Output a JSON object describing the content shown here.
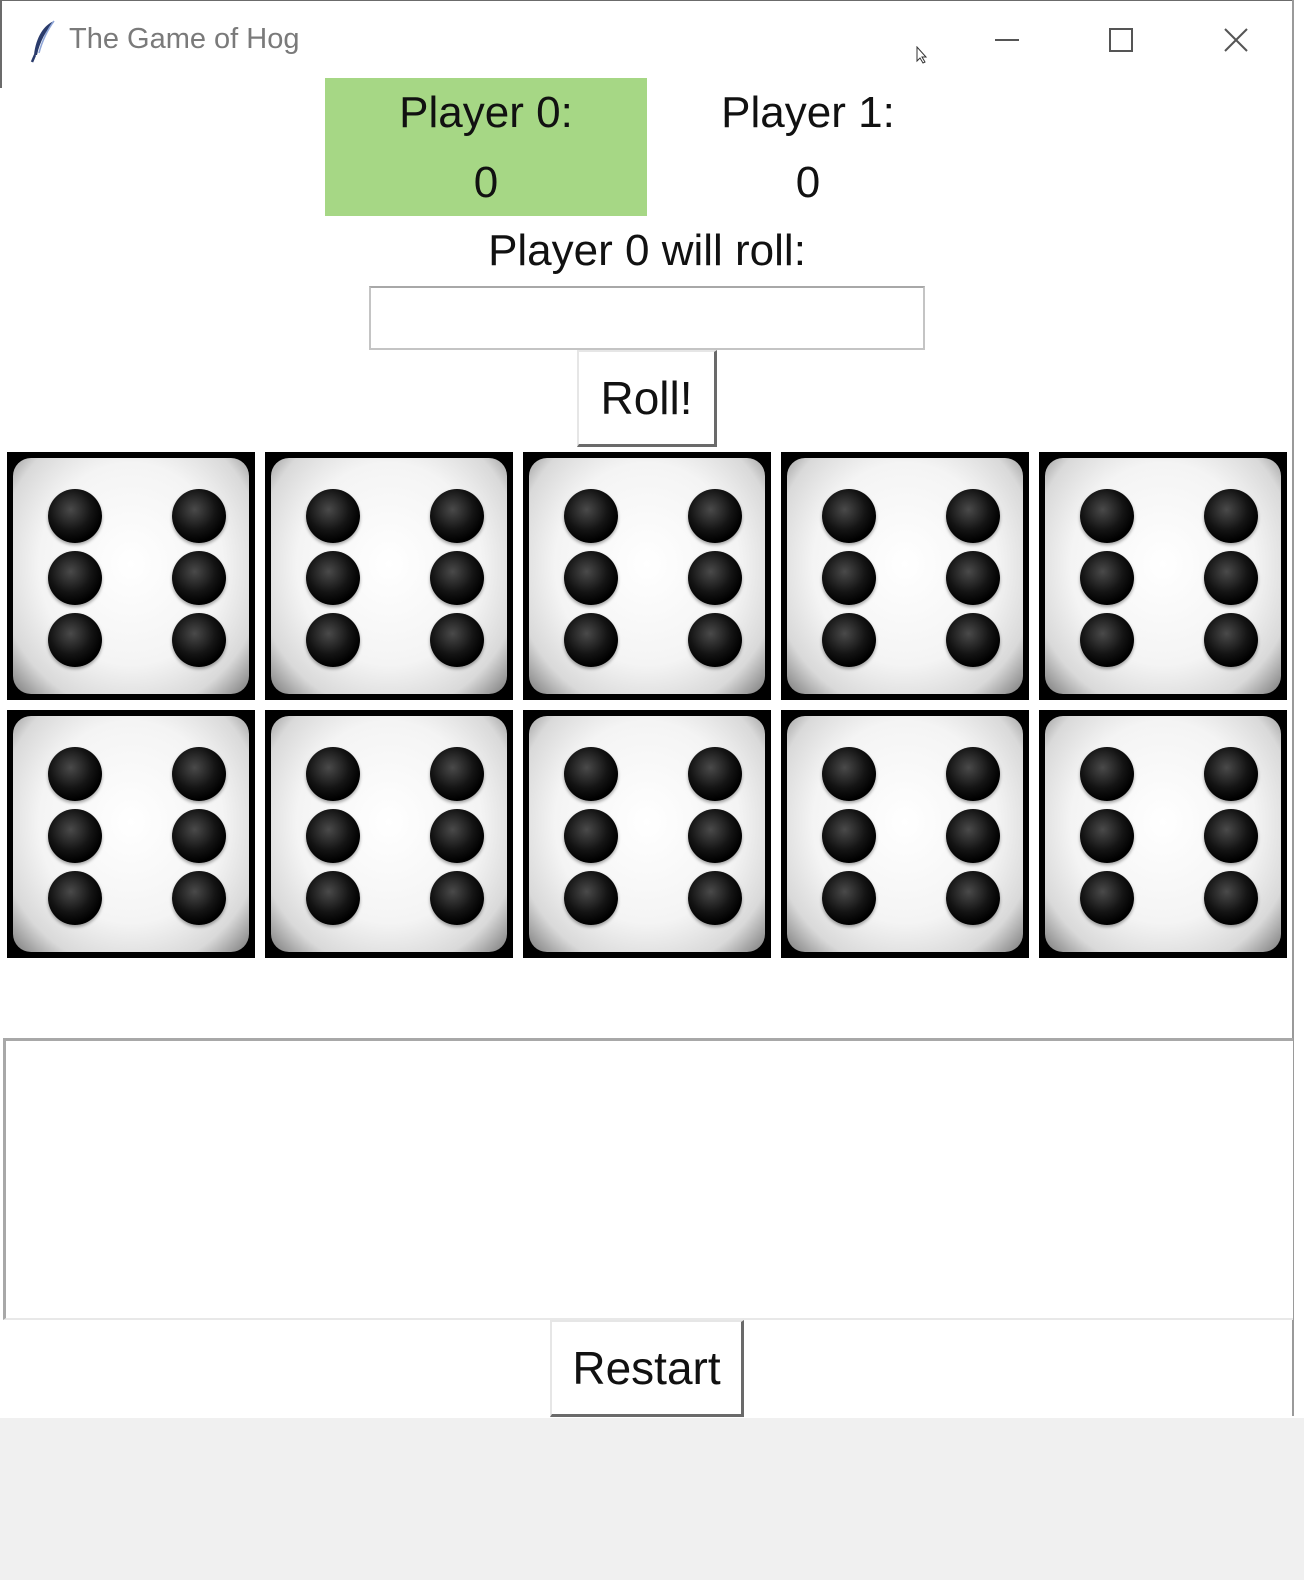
{
  "window": {
    "title": "The Game of Hog",
    "icon": "feather-icon",
    "controls": [
      "minimize-icon",
      "maximize-icon",
      "close-icon"
    ]
  },
  "players": [
    {
      "label": "Player 0:",
      "score": "0",
      "active": true
    },
    {
      "label": "Player 1:",
      "score": "0",
      "active": false
    }
  ],
  "prompt": "Player 0 will roll:",
  "roll_input": {
    "value": "",
    "placeholder": ""
  },
  "buttons": {
    "roll": "Roll!",
    "restart": "Restart"
  },
  "dice": [
    6,
    6,
    6,
    6,
    6,
    6,
    6,
    6,
    6,
    6
  ],
  "output_text": "",
  "colors": {
    "active_player": "#a6d785",
    "background": "#ffffff",
    "footer": "#f0f0f0"
  }
}
